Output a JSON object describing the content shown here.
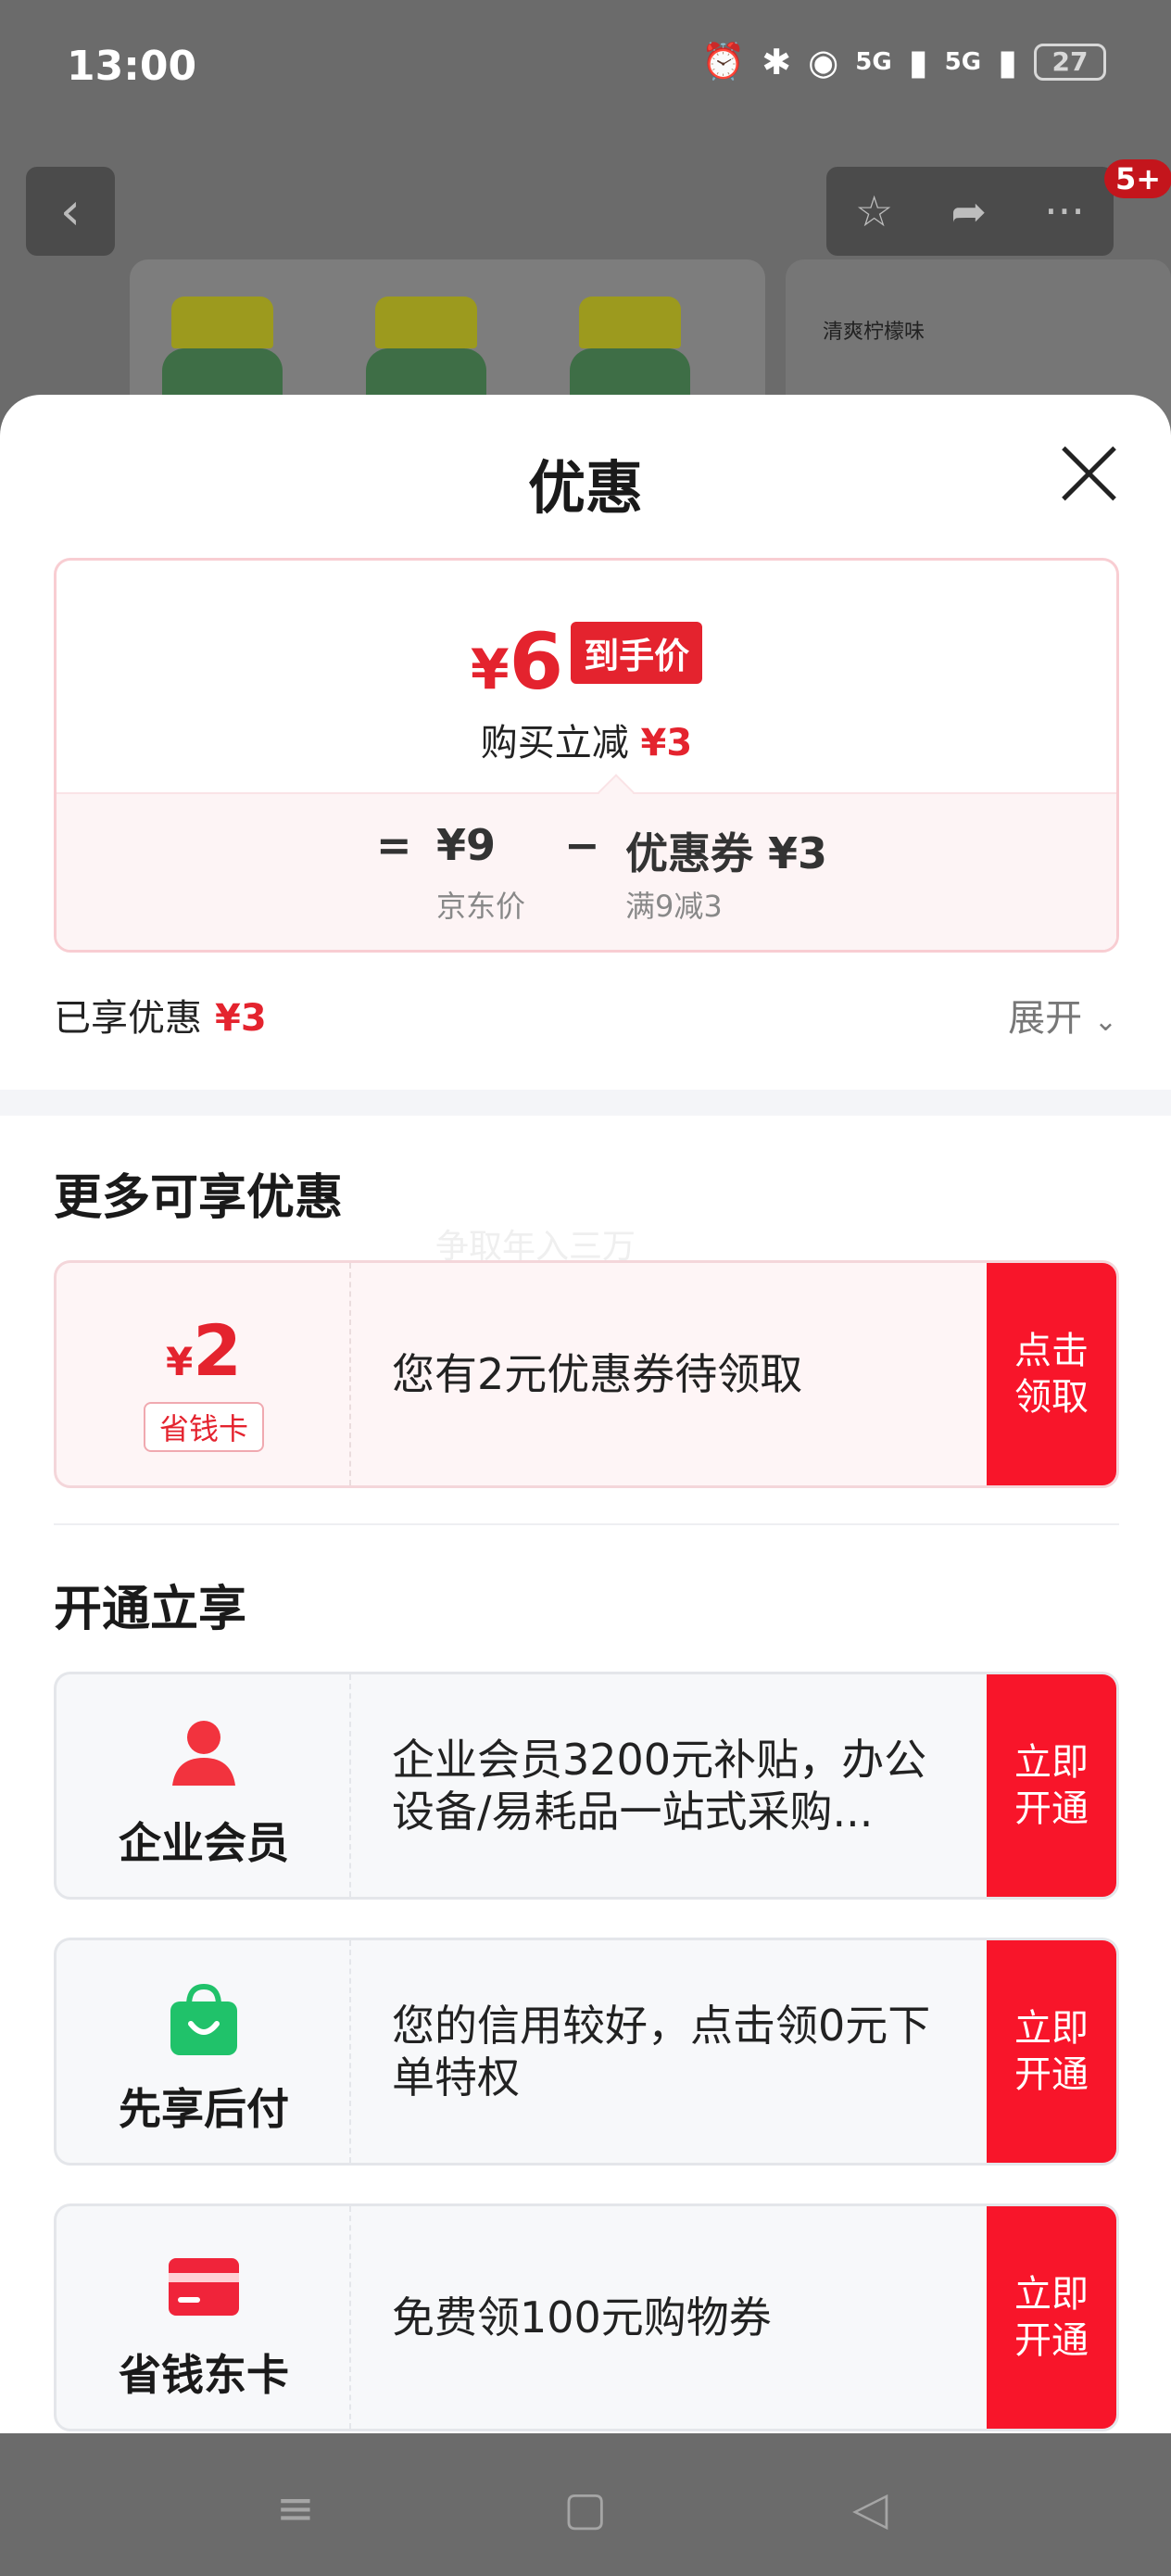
{
  "status_bar": {
    "time": "13:00",
    "network1": "5G",
    "network2": "5G",
    "battery": "27"
  },
  "background": {
    "cart_badge": "5+",
    "side_card_text": "清爽柠檬味"
  },
  "sheet": {
    "title": "优惠",
    "price": {
      "currency": "¥",
      "final_price": "6",
      "final_tag": "到手价",
      "instant_cut_label": "购买立减",
      "instant_cut_value": "¥3",
      "equals": "=",
      "jd_price": "¥9",
      "jd_price_label": "京东价",
      "minus": "−",
      "coupon": "优惠券 ¥3",
      "coupon_rule": "满9减3"
    },
    "saved_label": "已享优惠",
    "saved_value": "¥3",
    "expand_label": "展开",
    "more_title": "更多可享优惠",
    "watermark": "争取年入三万",
    "money_card": {
      "currency": "¥",
      "amount": "2",
      "label": "省钱卡",
      "text": "您有2元优惠券待领取",
      "button": "点击领取"
    },
    "open_title": "开通立享",
    "open_items": [
      {
        "name": "企业会员",
        "text": "企业会员3200元补贴，办公设备/易耗品一站式采购...",
        "button": "立即开通",
        "icon": "person-icon",
        "color": "#f2333e"
      },
      {
        "name": "先享后付",
        "text": "您的信用较好，点击领0元下单特权",
        "button": "立即开通",
        "icon": "shopping-bag-icon",
        "color": "#20c26a"
      },
      {
        "name": "省钱东卡",
        "text": "免费领100元购物券",
        "button": "立即开通",
        "icon": "card-icon",
        "color": "#f0243a"
      }
    ]
  },
  "nav": {
    "menu": "≡",
    "home": "▢",
    "back": "◁"
  }
}
